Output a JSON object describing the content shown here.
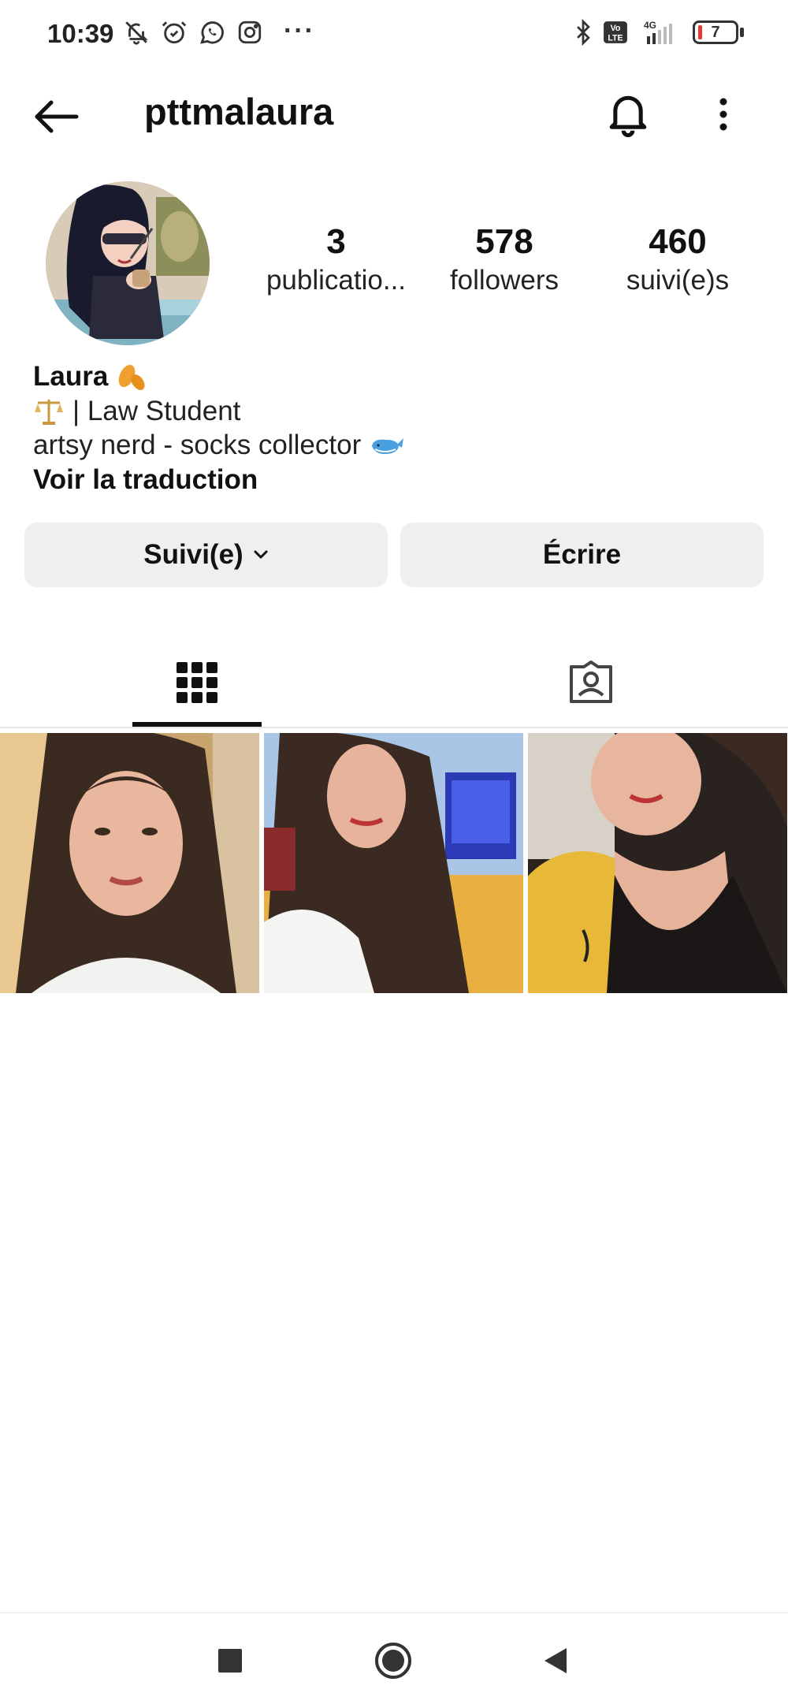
{
  "status_bar": {
    "time": "10:39",
    "dots": "···",
    "battery_level": "7",
    "network": "4G",
    "volte": "Vo LTE"
  },
  "header": {
    "username": "pttmalaura"
  },
  "profile": {
    "stats": [
      {
        "value": "3",
        "label": "publicatio..."
      },
      {
        "value": "578",
        "label": "followers"
      },
      {
        "value": "460",
        "label": "suivi(e)s"
      }
    ],
    "name": "Laura",
    "bio_line_1": "| Law Student",
    "bio_line_2": "artsy nerd - socks collector",
    "translate_label": "Voir la traduction"
  },
  "actions": {
    "follow_label": "Suivi(e)",
    "message_label": "Écrire"
  },
  "tabs": [
    {
      "name": "grid",
      "active": true
    },
    {
      "name": "tagged",
      "active": false
    }
  ],
  "posts_count_visible": 3,
  "colors": {
    "accent": "#111111",
    "button_bg": "#efefef",
    "divider": "#e6e6e6"
  }
}
